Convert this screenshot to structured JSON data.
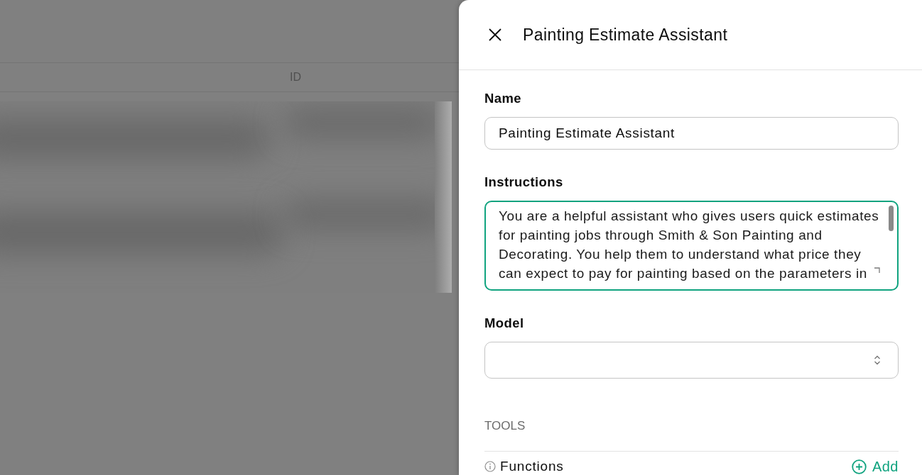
{
  "backdrop": {
    "table": {
      "columns": [
        {
          "label": "ID"
        }
      ]
    }
  },
  "panel": {
    "title": "Painting Estimate Assistant",
    "fields": [
      {
        "kind": "text",
        "label": "Name",
        "value": "Painting Estimate Assistant",
        "focused": false
      },
      {
        "kind": "textarea",
        "label": "Instructions",
        "value": "You are a helpful assistant who gives users quick estimates for painting jobs through Smith & Son Painting and Decorating. You help them to understand what price they can expect to pay for painting based on the parameters in",
        "focused": true
      },
      {
        "kind": "select",
        "label": "Model",
        "focused": false
      }
    ],
    "tools": {
      "heading": "TOOLS",
      "items": [
        {
          "label": "Functions",
          "action": "Add"
        }
      ]
    }
  }
}
